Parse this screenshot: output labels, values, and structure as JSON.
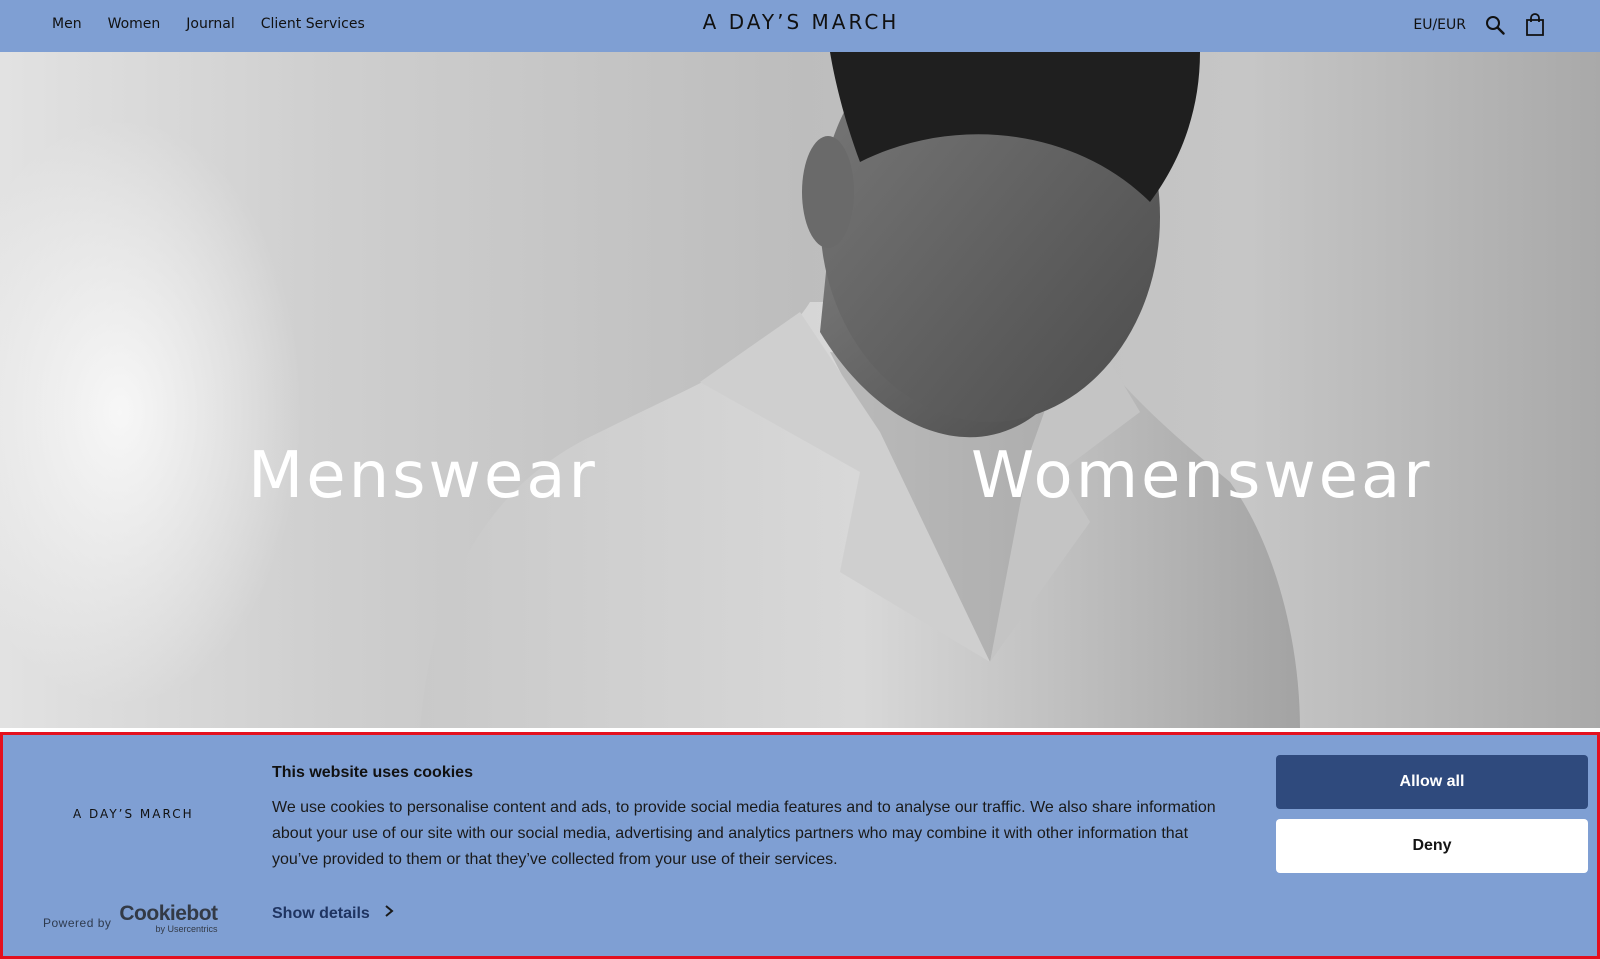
{
  "header": {
    "nav": [
      "Men",
      "Women",
      "Journal",
      "Client Services"
    ],
    "brand": "A DAY’S MARCH",
    "currency": "EU/EUR",
    "icons": [
      "search-icon",
      "bag-icon"
    ],
    "background_color": "#7f9fd3"
  },
  "hero": {
    "menswear_label": "Menswear",
    "womenswear_label": "Womenswear"
  },
  "cookie_banner": {
    "logo_text": "A DAY’S MARCH",
    "powered_by": "Powered by",
    "provider": "Cookiebot",
    "provider_sub": "by Usercentrics",
    "title": "This website uses cookies",
    "body": "We use cookies to personalise content and ads, to provide social media features and to analyse our traffic. We also share information about your use of our site with our social media, advertising and analytics partners who may combine it with other information that you’ve provided to them or that they’ve collected from your use of their services.",
    "show_details": "Show details",
    "allow_all": "Allow all",
    "deny": "Deny",
    "colors": {
      "background": "#7f9fd3",
      "allow_button": "#2f4a7d",
      "highlight_border": "#e4101e"
    }
  }
}
